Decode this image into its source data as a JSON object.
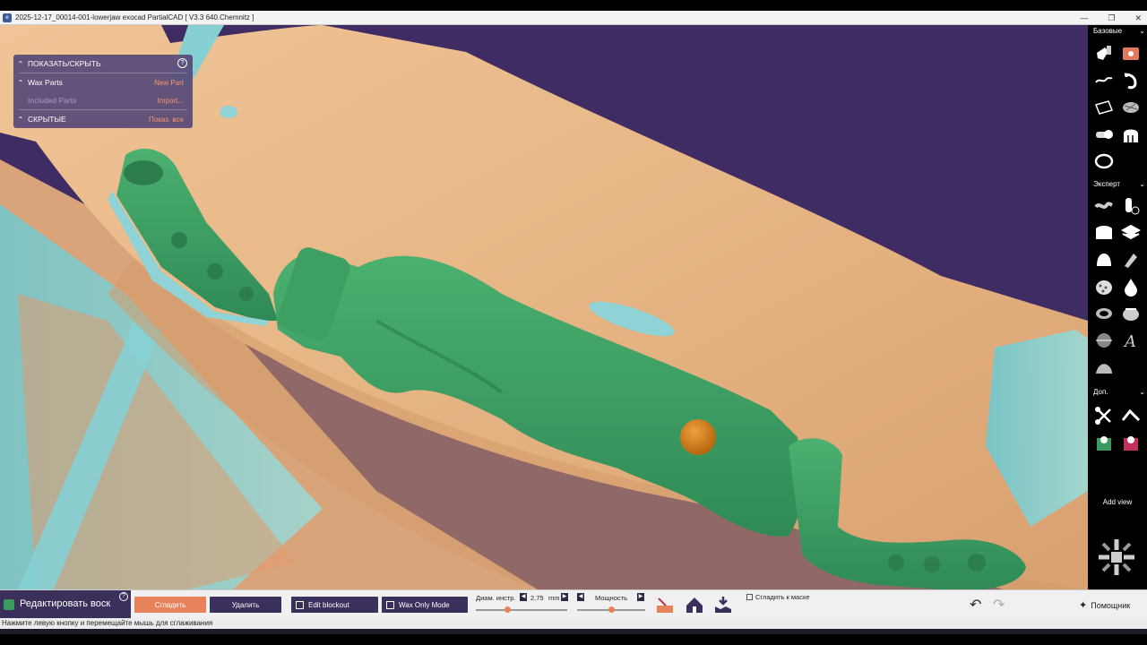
{
  "window": {
    "title": "2025-12-17_00014-001-lowerjaw exocad PartialCAD [ V3.3 640.Chemnitz ]",
    "app_icon": "exocad-app-icon",
    "controls": [
      "minimize-icon",
      "restore-icon",
      "close-icon"
    ]
  },
  "panel": {
    "show_hide": "ПОКАЗАТЬ/СКРЫТЬ",
    "help": "?",
    "rows": [
      {
        "label": "Wax Parts",
        "action": "New Part"
      },
      {
        "label": "Included Parts",
        "action": "Import..."
      },
      {
        "label": "СКРЫТЫЕ",
        "action": "Показ. все"
      }
    ]
  },
  "toolbar": {
    "section_basic": "Базовые",
    "section_expert": "Эксперт",
    "section_extra": "Доп.",
    "add_view": "Add view"
  },
  "bottom": {
    "mode_label": "Редактировать воск",
    "help": "?",
    "smooth_button": "Сгладить",
    "delete_button": "Удалить",
    "edit_blockout": "Edit blockout",
    "wax_only_mode": "Wax Only Mode",
    "diam_label": "Диам. инстр.",
    "diam_value": "2.75",
    "diam_unit": "mm",
    "power_label": "Мощность",
    "smooth_to_mask": "Сгладить к маске",
    "assistant": "Помощник"
  },
  "status": {
    "hint": "Нажмите левую кнопку и перемещайте мышь для сглаживания"
  },
  "colors": {
    "background": "#3e2c63",
    "model": "#e8b98a",
    "wax": "#3a9a60",
    "blockout": "#7fd0d0",
    "accent": "#e8825a",
    "button_dark": "#3b2f5c"
  },
  "sliders": {
    "diameter_fraction": 0.35,
    "power_fraction": 0.5
  }
}
